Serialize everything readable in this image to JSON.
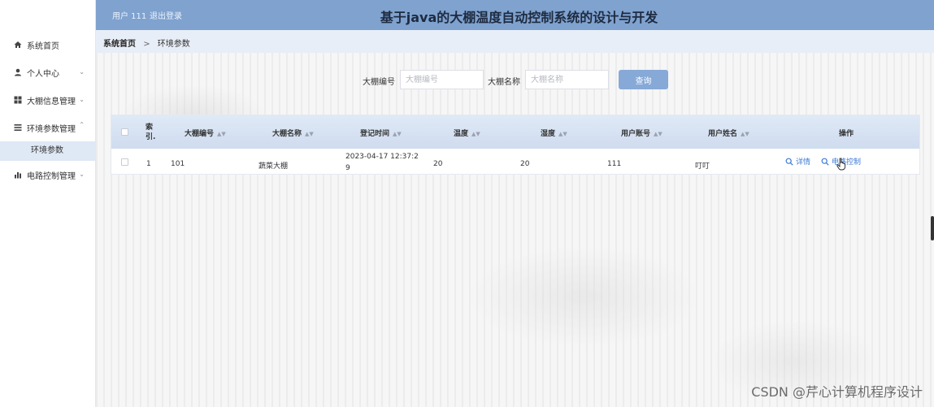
{
  "header": {
    "user": "用户 111",
    "logout": "退出登录",
    "title": "基于java的大棚温度自动控制系统的设计与开发"
  },
  "sidebar": {
    "items": [
      {
        "label": "系统首页",
        "icon": "home-icon"
      },
      {
        "label": "个人中心",
        "icon": "user-icon",
        "chevron": "down"
      },
      {
        "label": "大棚信息管理",
        "icon": "grid-icon",
        "chevron": "down"
      },
      {
        "label": "环境参数管理",
        "icon": "list-icon",
        "chevron": "up"
      },
      {
        "label": "电路控制管理",
        "icon": "bar-chart-icon",
        "chevron": "down"
      }
    ],
    "submenu": {
      "label": "环境参数"
    }
  },
  "breadcrumb": {
    "home": "系统首页",
    "separator": ">",
    "current": "环境参数"
  },
  "search": {
    "field1_label": "大棚编号",
    "field1_placeholder": "大棚编号",
    "field2_label": "大棚名称",
    "field2_placeholder": "大棚名称",
    "button": "查询"
  },
  "table": {
    "headers": {
      "index_line1": "索",
      "index_line2": "引.",
      "greenhouse_no": "大棚编号",
      "greenhouse_name": "大棚名称",
      "reg_time": "登记时间",
      "temperature": "温度",
      "humidity": "湿度",
      "user_account": "用户账号",
      "user_name": "用户姓名",
      "actions": "操作"
    },
    "rows": [
      {
        "index": "1",
        "greenhouse_no": "101",
        "greenhouse_name": "蔬菜大棚",
        "reg_time_line1": "2023-04-17 12:37:2",
        "reg_time_line2": "9",
        "temperature": "20",
        "humidity": "20",
        "user_account": "111",
        "user_name": "叮叮",
        "action_detail": "详情",
        "action_control": "电路控制"
      }
    ]
  },
  "watermark": "CSDN @芹心计算机程序设计",
  "colors": {
    "header_bg": "#7fa2cf",
    "button_bg": "#86a9d7",
    "link": "#3c7bd6",
    "submenu_bg": "#dfe8f5"
  }
}
